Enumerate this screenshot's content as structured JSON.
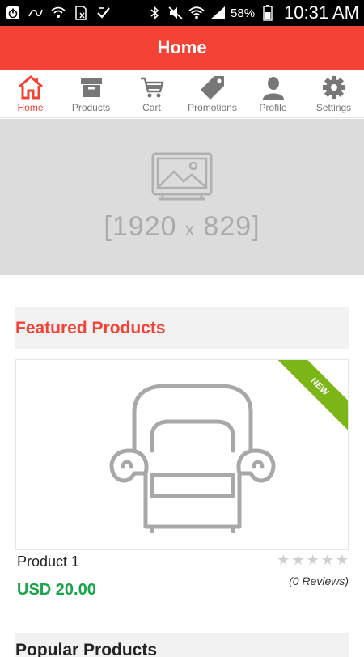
{
  "status_bar": {
    "battery_percent": "58%",
    "time": "10:31 AM",
    "icons": [
      "power-icon",
      "nfc-icon",
      "wifi-call-icon",
      "sim-icon",
      "check-icon",
      "bluetooth-icon",
      "mute-icon",
      "wifi-icon",
      "signal-icon",
      "battery-icon"
    ]
  },
  "header": {
    "title": "Home"
  },
  "tabs": [
    {
      "label": "Home",
      "icon": "home-icon",
      "active": true
    },
    {
      "label": "Products",
      "icon": "archive-box-icon",
      "active": false
    },
    {
      "label": "Cart",
      "icon": "cart-icon",
      "active": false
    },
    {
      "label": "Promotions",
      "icon": "tag-icon",
      "active": false
    },
    {
      "label": "Profile",
      "icon": "person-icon",
      "active": false
    },
    {
      "label": "Settings",
      "icon": "gear-icon",
      "active": false
    }
  ],
  "banner": {
    "placeholder": "[1920",
    "x": "x",
    "height": "829]"
  },
  "featured": {
    "title": "Featured Products",
    "product": {
      "badge": "NEW",
      "name": "Product 1",
      "price": "USD 20.00",
      "rating_stars": 0,
      "reviews": "(0 Reviews)"
    }
  },
  "next_section": {
    "title": "Popular Products"
  },
  "colors": {
    "accent": "#f44336",
    "price": "#1aa34a",
    "badge": "#7cb518"
  }
}
